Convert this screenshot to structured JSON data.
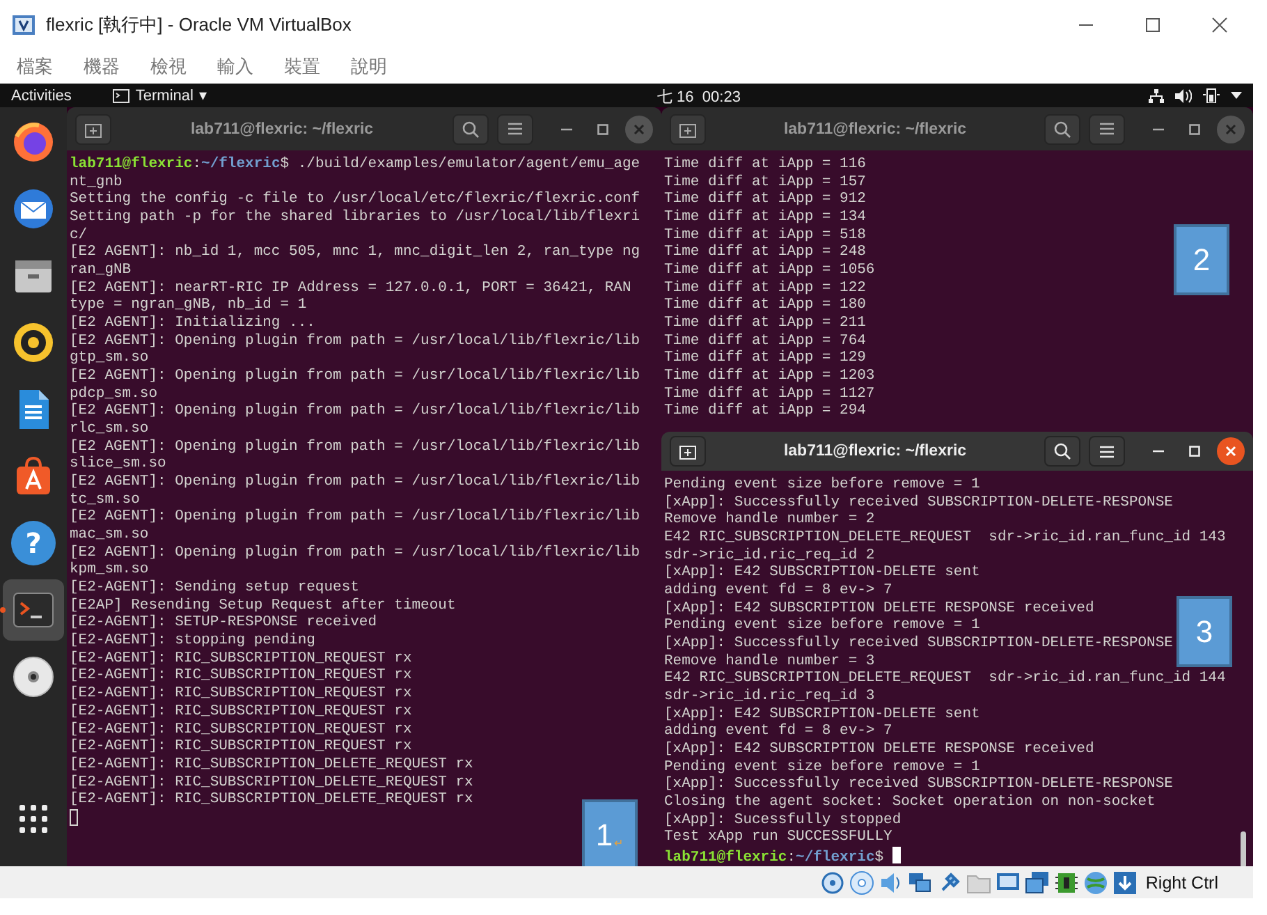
{
  "window": {
    "title": "flexric [執行中] - Oracle VM VirtualBox"
  },
  "menu": [
    "檔案",
    "機器",
    "檢視",
    "輸入",
    "裝置",
    "說明"
  ],
  "top_bar": {
    "activities": "Activities",
    "app_menu": "Terminal",
    "app_menu_caret": "▾",
    "clock": "七 16  00:23"
  },
  "dock": {
    "items": [
      {
        "kind": "browser",
        "selected": false
      },
      {
        "kind": "mail",
        "selected": false
      },
      {
        "kind": "files",
        "selected": false
      },
      {
        "kind": "audio",
        "selected": false
      },
      {
        "kind": "writer",
        "selected": false
      },
      {
        "kind": "store",
        "selected": false
      },
      {
        "kind": "help",
        "glyph": "?",
        "selected": false
      },
      {
        "kind": "terminal",
        "selected": true
      },
      {
        "kind": "disc",
        "selected": false
      }
    ]
  },
  "terminals": [
    {
      "title": "lab711@flexric: ~/flexric",
      "focused": false,
      "has_cursor": true,
      "cursor_on_new_line": true,
      "note": {
        "number": "1",
        "mark": "↵"
      },
      "lines": [
        {
          "kind": "prompt",
          "user": "lab711@flexric",
          "separator": ":",
          "path": "~/flexric",
          "symbol": "$",
          "command": " ./build/examples/emulator/agent/emu_agent_gnb"
        },
        {
          "kind": "output",
          "text": "Setting the config -c file to /usr/local/etc/flexric/flexric.conf"
        },
        {
          "kind": "output",
          "text": "Setting path -p for the shared libraries to /usr/local/lib/flexric/"
        },
        {
          "kind": "output",
          "text": "[E2 AGENT]: nb_id 1, mcc 505, mnc 1, mnc_digit_len 2, ran_type ngran_gNB"
        },
        {
          "kind": "output",
          "text": "[E2 AGENT]: nearRT-RIC IP Address = 127.0.0.1, PORT = 36421, RAN type = ngran_gNB, nb_id = 1"
        },
        {
          "kind": "output",
          "text": "[E2 AGENT]: Initializing ..."
        },
        {
          "kind": "output",
          "text": "[E2 AGENT]: Opening plugin from path = /usr/local/lib/flexric/libgtp_sm.so"
        },
        {
          "kind": "output",
          "text": "[E2 AGENT]: Opening plugin from path = /usr/local/lib/flexric/libpdcp_sm.so"
        },
        {
          "kind": "output",
          "text": "[E2 AGENT]: Opening plugin from path = /usr/local/lib/flexric/librlc_sm.so"
        },
        {
          "kind": "output",
          "text": "[E2 AGENT]: Opening plugin from path = /usr/local/lib/flexric/libslice_sm.so"
        },
        {
          "kind": "output",
          "text": "[E2 AGENT]: Opening plugin from path = /usr/local/lib/flexric/libtc_sm.so"
        },
        {
          "kind": "output",
          "text": "[E2 AGENT]: Opening plugin from path = /usr/local/lib/flexric/libmac_sm.so"
        },
        {
          "kind": "output",
          "text": "[E2 AGENT]: Opening plugin from path = /usr/local/lib/flexric/libkpm_sm.so"
        },
        {
          "kind": "output",
          "text": "[E2-AGENT]: Sending setup request"
        },
        {
          "kind": "output",
          "text": "[E2AP] Resending Setup Request after timeout"
        },
        {
          "kind": "output",
          "text": "[E2-AGENT]: SETUP-RESPONSE received"
        },
        {
          "kind": "output",
          "text": "[E2-AGENT]: stopping pending"
        },
        {
          "kind": "output",
          "text": "[E2-AGENT]: RIC_SUBSCRIPTION_REQUEST rx"
        },
        {
          "kind": "output",
          "text": "[E2-AGENT]: RIC_SUBSCRIPTION_REQUEST rx"
        },
        {
          "kind": "output",
          "text": "[E2-AGENT]: RIC_SUBSCRIPTION_REQUEST rx"
        },
        {
          "kind": "output",
          "text": "[E2-AGENT]: RIC_SUBSCRIPTION_REQUEST rx"
        },
        {
          "kind": "output",
          "text": "[E2-AGENT]: RIC_SUBSCRIPTION_REQUEST rx"
        },
        {
          "kind": "output",
          "text": "[E2-AGENT]: RIC_SUBSCRIPTION_REQUEST rx"
        },
        {
          "kind": "output",
          "text": "[E2-AGENT]: RIC_SUBSCRIPTION_DELETE_REQUEST rx"
        },
        {
          "kind": "output",
          "text": "[E2-AGENT]: RIC_SUBSCRIPTION_DELETE_REQUEST rx"
        },
        {
          "kind": "output",
          "text": "[E2-AGENT]: RIC_SUBSCRIPTION_DELETE_REQUEST rx"
        }
      ]
    },
    {
      "title": "lab711@flexric: ~/flexric",
      "focused": false,
      "note": {
        "number": "2"
      },
      "lines": [
        {
          "kind": "output",
          "text": "Time diff at iApp = 116"
        },
        {
          "kind": "output",
          "text": "Time diff at iApp = 157"
        },
        {
          "kind": "output",
          "text": "Time diff at iApp = 912"
        },
        {
          "kind": "output",
          "text": "Time diff at iApp = 134"
        },
        {
          "kind": "output",
          "text": "Time diff at iApp = 518"
        },
        {
          "kind": "output",
          "text": "Time diff at iApp = 248"
        },
        {
          "kind": "output",
          "text": "Time diff at iApp = 1056"
        },
        {
          "kind": "output",
          "text": "Time diff at iApp = 122"
        },
        {
          "kind": "output",
          "text": "Time diff at iApp = 180"
        },
        {
          "kind": "output",
          "text": "Time diff at iApp = 211"
        },
        {
          "kind": "output",
          "text": "Time diff at iApp = 764"
        },
        {
          "kind": "output",
          "text": "Time diff at iApp = 129"
        },
        {
          "kind": "output",
          "text": "Time diff at iApp = 1203"
        },
        {
          "kind": "output",
          "text": "Time diff at iApp = 1127"
        },
        {
          "kind": "output",
          "text": "Time diff at iApp = 294"
        }
      ]
    },
    {
      "title": "lab711@flexric: ~/flexric",
      "focused": true,
      "has_cursor": true,
      "cursor_on_new_line": false,
      "note": {
        "number": "3"
      },
      "lines": [
        {
          "kind": "output",
          "text": "Pending event size before remove = 1"
        },
        {
          "kind": "output",
          "text": "[xApp]: Successfully received SUBSCRIPTION-DELETE-RESPONSE"
        },
        {
          "kind": "output",
          "text": "Remove handle number = 2"
        },
        {
          "kind": "output",
          "text": "E42 RIC_SUBSCRIPTION_DELETE_REQUEST  sdr->ric_id.ran_func_id 143  sdr->ric_id.ric_req_id 2"
        },
        {
          "kind": "output",
          "text": "[xApp]: E42 SUBSCRIPTION-DELETE sent"
        },
        {
          "kind": "output",
          "text": "adding event fd = 8 ev-> 7"
        },
        {
          "kind": "output",
          "text": "[xApp]: E42 SUBSCRIPTION DELETE RESPONSE received"
        },
        {
          "kind": "output",
          "text": "Pending event size before remove = 1"
        },
        {
          "kind": "output",
          "text": "[xApp]: Successfully received SUBSCRIPTION-DELETE-RESPONSE"
        },
        {
          "kind": "output",
          "text": "Remove handle number = 3"
        },
        {
          "kind": "output",
          "text": "E42 RIC_SUBSCRIPTION_DELETE_REQUEST  sdr->ric_id.ran_func_id 144  sdr->ric_id.ric_req_id 3"
        },
        {
          "kind": "output",
          "text": "[xApp]: E42 SUBSCRIPTION-DELETE sent"
        },
        {
          "kind": "output",
          "text": "adding event fd = 8 ev-> 7"
        },
        {
          "kind": "output",
          "text": "[xApp]: E42 SUBSCRIPTION DELETE RESPONSE received"
        },
        {
          "kind": "output",
          "text": "Pending event size before remove = 1"
        },
        {
          "kind": "output",
          "text": "[xApp]: Successfully received SUBSCRIPTION-DELETE-RESPONSE"
        },
        {
          "kind": "output",
          "text": "Closing the agent socket: Socket operation on non-socket"
        },
        {
          "kind": "output",
          "text": "[xApp]: Sucessfully stopped"
        },
        {
          "kind": "output",
          "text": "Test xApp run SUCCESSFULLY"
        },
        {
          "kind": "prompt",
          "user": "lab711@flexric",
          "separator": ":",
          "path": "~/flexric",
          "symbol": "$"
        }
      ]
    }
  ],
  "status_bar": {
    "host_key": "Right Ctrl"
  }
}
